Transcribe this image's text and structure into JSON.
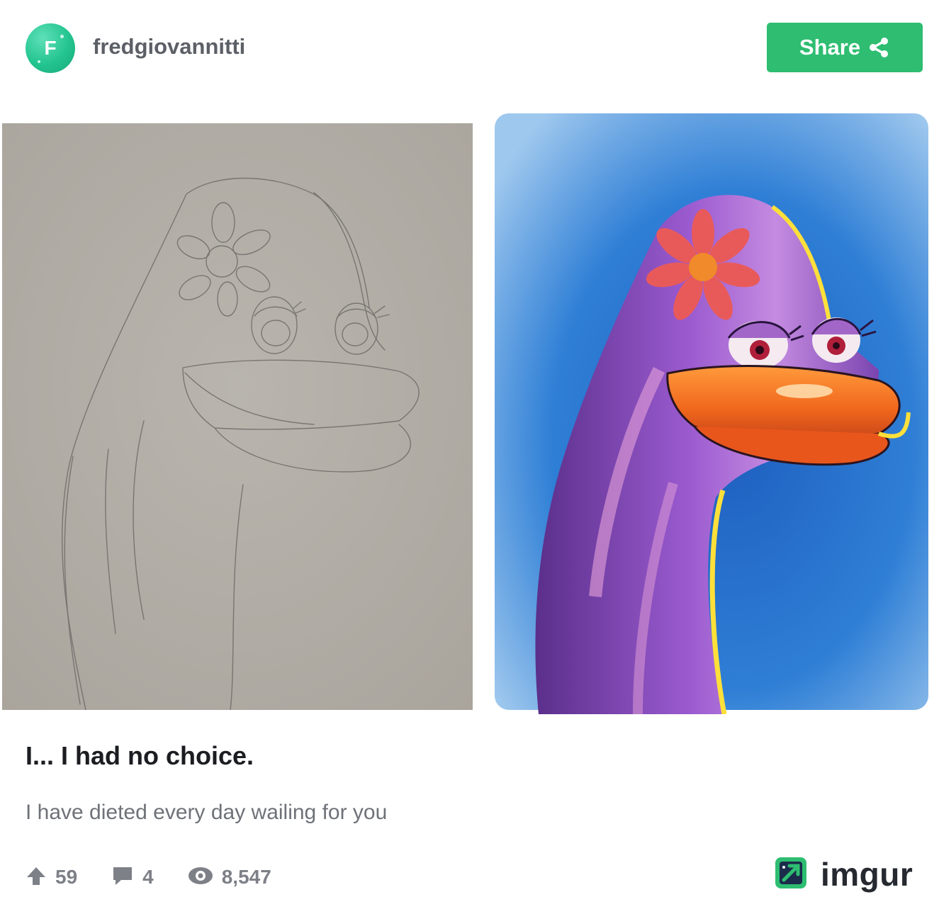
{
  "header": {
    "avatar_letter": "F",
    "username": "fredgiovannitti",
    "share_label": "Share"
  },
  "post": {
    "title": "I... I had no choice.",
    "description": "I have dieted every day wailing for you"
  },
  "stats": {
    "upvotes": "59",
    "comments": "4",
    "views": "8,547"
  },
  "brand": {
    "name": "imgur"
  },
  "colors": {
    "accent": "#2ebd71",
    "avatar": "#23c48f",
    "text_dark": "#1b1d21",
    "text_muted": "#6e7278"
  },
  "icons": [
    "share-icon",
    "upvote-icon",
    "comment-icon",
    "views-icon",
    "imgur-logo-icon"
  ]
}
